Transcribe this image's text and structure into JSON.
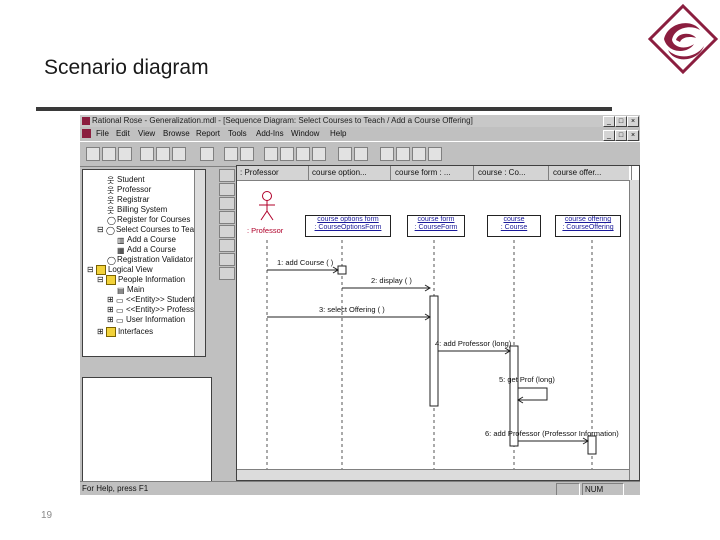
{
  "slide": {
    "title": "Scenario diagram",
    "page_number": "19"
  },
  "colors": {
    "logo": "#8b1e3f",
    "folder": "#f2d23a",
    "object_text": "#1a1a9a",
    "actor_label": "#b0002a"
  },
  "window": {
    "title": "Rational Rose - Generalization.mdl - [Sequence Diagram: Select Courses to Teach / Add a Course Offering]",
    "menu": [
      "File",
      "Edit",
      "View",
      "Browse",
      "Report",
      "Tools",
      "Add-Ins",
      "Window",
      "Help"
    ]
  },
  "browser": {
    "items": [
      "Student",
      "Professor",
      "Registrar",
      "Billing System",
      "Register for Courses",
      "Select Courses to Teach",
      "Add a Course",
      "Add a Course",
      "Registration Validator",
      "Logical View",
      "People Information",
      "Main",
      "<<Entity>> Student",
      "<<Entity>> Professor",
      "User Information",
      "Interfaces"
    ]
  },
  "diagram": {
    "headers": [
      ": Professor",
      "course option...",
      "course form : ...",
      "course : Co...",
      "course offer..."
    ],
    "actor_label": ": Professor",
    "objects": [
      {
        "line1": "course options form",
        "line2": ": CourseOptionsForm"
      },
      {
        "line1": "course form",
        "line2": ": CourseForm"
      },
      {
        "line1": "course",
        "line2": ": Course"
      },
      {
        "line1": "course offering",
        "line2": ": CourseOffering"
      }
    ],
    "messages": [
      "1: add Course ( )",
      "2: display ( )",
      "3: select Offering ( )",
      "4: add Professor (long)",
      "5: get Prof (long)",
      "6: add Professor (Professor Information)"
    ]
  },
  "status": {
    "help_text": "For Help, press F1",
    "num": "NUM"
  }
}
